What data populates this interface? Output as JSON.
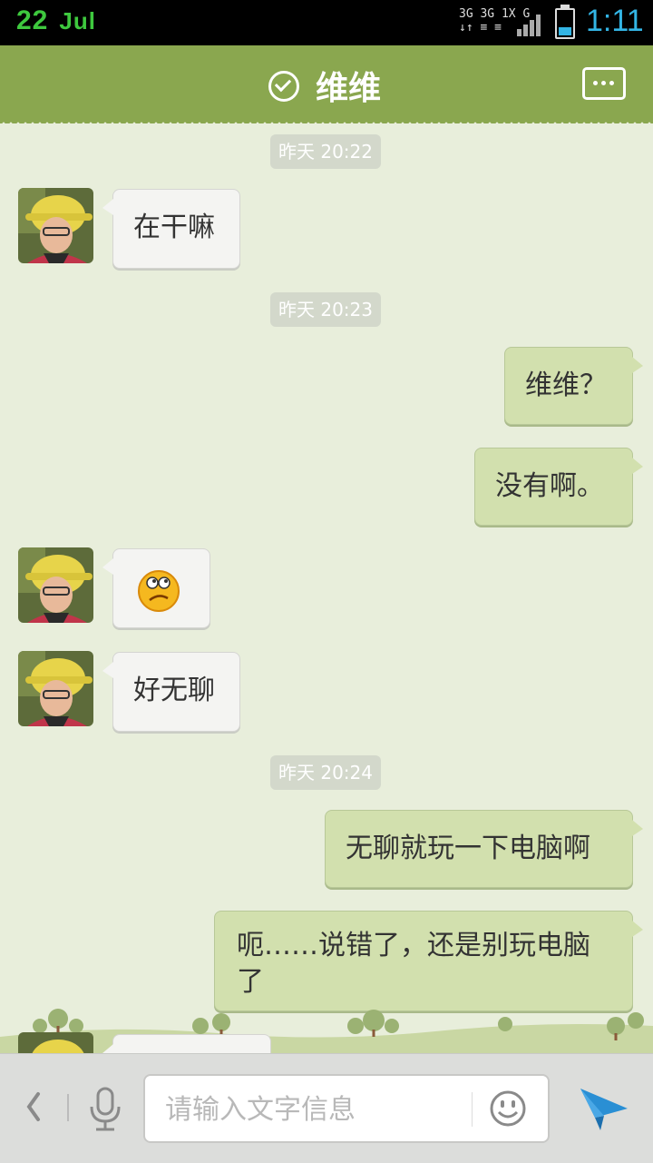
{
  "status_bar": {
    "date_day": "22",
    "date_month": "Jul",
    "net_line1": "3G 3G 1X  G",
    "net_line2": "↓↑ ≡  ≡",
    "time": "1:11"
  },
  "header": {
    "contact_name": "维维",
    "verified_icon": "check-circle-icon",
    "more_icon": "more-dots-icon"
  },
  "timestamps": [
    "昨天 20:22",
    "昨天 20:23",
    "昨天 20:24"
  ],
  "messages": [
    {
      "from": "contact",
      "text": "在干嘛"
    },
    {
      "from": "me",
      "text": "维维？"
    },
    {
      "from": "me",
      "text": "没有啊。"
    },
    {
      "from": "contact",
      "emoji": "confused-face-emoji"
    },
    {
      "from": "contact",
      "text": "好无聊"
    },
    {
      "from": "me",
      "text": "无聊就玩一下电脑啊"
    },
    {
      "from": "me",
      "text": "呃……说错了，还是别玩电脑了"
    },
    {
      "from": "contact",
      "text": ""
    }
  ],
  "input_bar": {
    "placeholder": "请输入文字信息",
    "value": ""
  },
  "colors": {
    "header_green": "#8aa74f",
    "chat_background": "#e8eedb",
    "outgoing_bubble": "#d2e0ae",
    "incoming_bubble": "#f4f4f2",
    "status_time_blue": "#33b5e5",
    "date_green": "#3ec83e"
  }
}
